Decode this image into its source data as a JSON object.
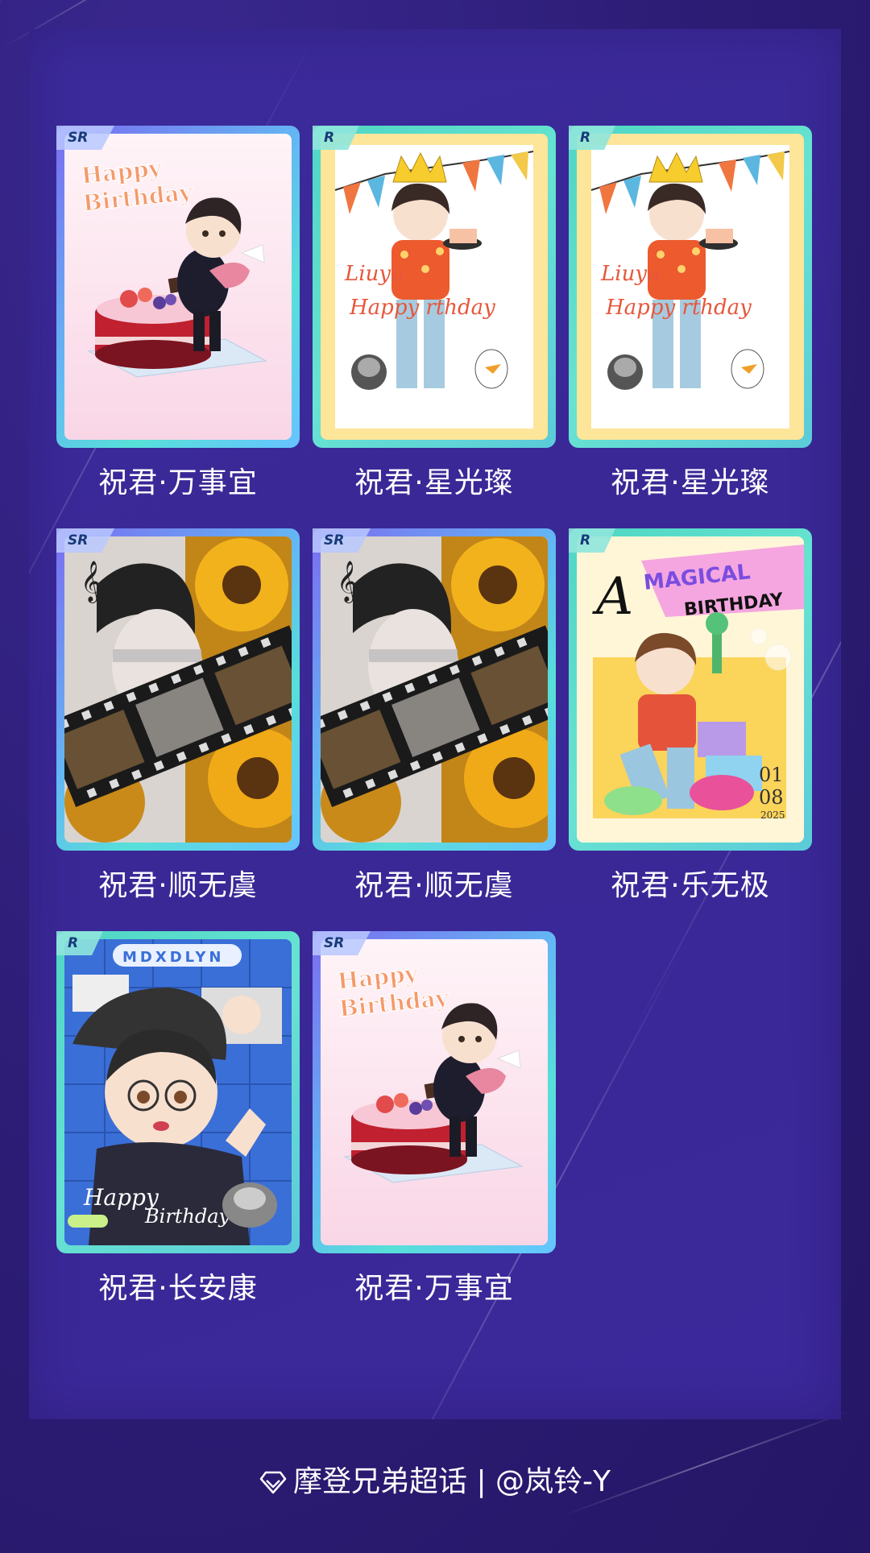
{
  "cards": [
    {
      "rarity": "SR",
      "title": "祝君·万事宜",
      "art": "cake"
    },
    {
      "rarity": "R",
      "title": "祝君·星光璨",
      "art": "party"
    },
    {
      "rarity": "R",
      "title": "祝君·星光璨",
      "art": "party"
    },
    {
      "rarity": "SR",
      "title": "祝君·顺无虞",
      "art": "film"
    },
    {
      "rarity": "SR",
      "title": "祝君·顺无虞",
      "art": "film"
    },
    {
      "rarity": "R",
      "title": "祝君·乐无极",
      "art": "magical"
    },
    {
      "rarity": "R",
      "title": "祝君·长安康",
      "art": "selfie"
    },
    {
      "rarity": "SR",
      "title": "祝君·万事宜",
      "art": "cake"
    }
  ],
  "art_text": {
    "happy": "Happy",
    "birthday": "Birthday",
    "liuyu": "Liuyu",
    "happy_birthday_short": "Happy  rthday",
    "magical": "MAGICAL",
    "a_letter": "A",
    "birthday_caps": "BIRTHDAY",
    "date_month": "01",
    "date_day": "08",
    "date_year": "2025",
    "mdxdlyn": "MDXDLYN",
    "happy_script": "Happy",
    "birthday_script": "Birthday"
  },
  "footer": {
    "icon": "diamond-icon",
    "text": "摩登兄弟超话 | @岚铃-Y"
  },
  "colors": {
    "background": "#2f1f78",
    "panel": "#3b2a9a",
    "sr_frame": "#63b8f3",
    "r_frame": "#4fd6c4",
    "caption": "#ffffff"
  }
}
